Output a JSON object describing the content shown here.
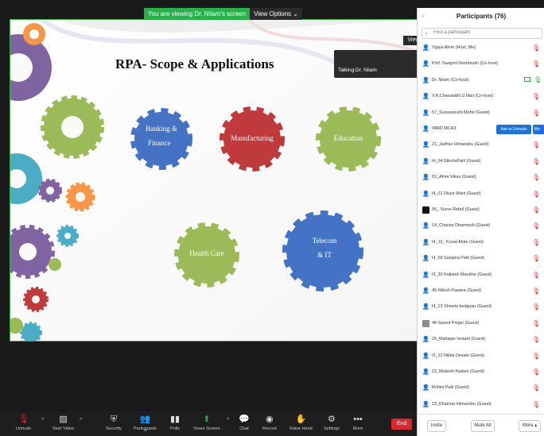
{
  "share_banner": {
    "text": "You are viewing Dr. Nilam's screen",
    "view_options": "View Options"
  },
  "view_button": "View",
  "talking": "Talking:Dr. Nilam",
  "slide": {
    "title": "RPA- Scope & Applications",
    "gears": {
      "banking_line1": "Banking &",
      "banking_line2": "Finance",
      "manufacturing": "Manufacturing",
      "education": "Education",
      "health": "Health Care",
      "telecom_line1": "Telecom",
      "telecom_line2": "& IT"
    },
    "colors": {
      "blue": "#4472c4",
      "red": "#c0393b",
      "green": "#9bbb59",
      "purple": "#8064a2",
      "orange": "#f79646",
      "teal": "#4bacc6"
    }
  },
  "toolbar": {
    "unmute": "Unmute",
    "start_video": "Start Video",
    "security": "Security",
    "participants": "Participants",
    "participants_count": "76",
    "polls": "Polls",
    "share_screen": "Share Screen",
    "chat": "Chat",
    "record": "Record",
    "raise_hand": "Raise Hand",
    "settings": "Settings",
    "more": "More",
    "end": "End"
  },
  "panel": {
    "title": "Participants (76)",
    "search_placeholder": "Find a participant",
    "ask_to_unmute": "Ask to Unmute",
    "more_small": "Mo",
    "participants": [
      "Vijaya Ahire (Host, Me)",
      "Prof. Swapnil Deshmukh (Co-host)",
      "Dr. Nilam (Co-host)",
      "V.N.Chavan&N.U.Mali (Co-host)",
      "57_Suryavanshi Mohit (Guest)",
      "IMRD MCA3",
      "21_Jadhav Himanshu (Guest)",
      "I4_04 DikshaPatil (Guest)",
      "02_Ahire Vikas (Guest)",
      "I4_01 Divya Wani (Guest)",
      "56_ Surve Rahul (Guest)",
      "14_Chavan Dharmesh (Guest)",
      "I4_10_ Kunal Ahire (Guest)",
      "I4_09 Sanjana Patil (Guest)",
      "I3_30 Kalpesh Marathe (Guest)",
      "45-Nilesh Pawara (Guest)",
      "I4_13 Shweta bedgujar (Guest)",
      "48-Saeed Pinjari (Guest)",
      "29_Mahajan Vedant (Guest)",
      "I3_12 Nikita Desale (Guest)",
      "22_Mukesh Kadam (Guest)",
      "Rohini Patil (Guest)",
      "23_Khairnar Himanshu (Guest)"
    ],
    "footer": {
      "invite": "Invite",
      "mute_all": "Mute All",
      "more": "More"
    }
  }
}
